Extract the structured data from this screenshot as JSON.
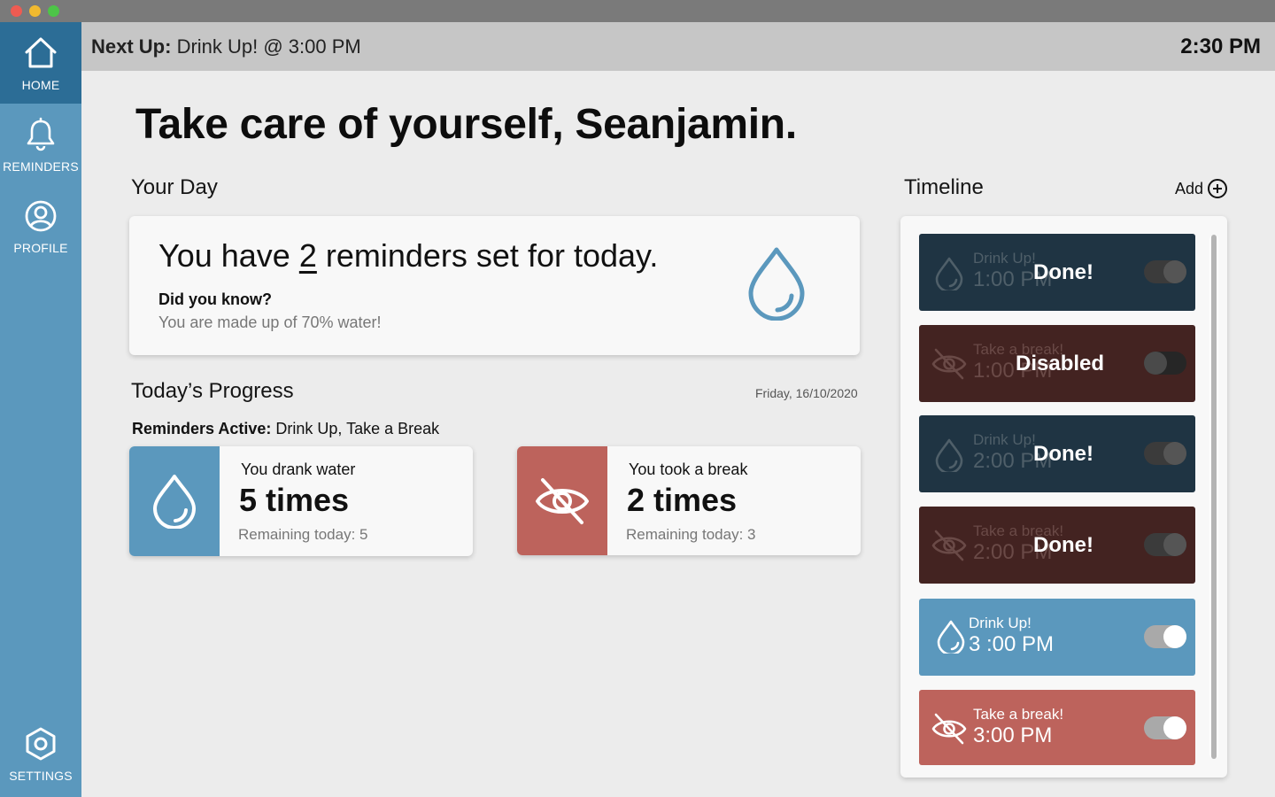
{
  "nav": {
    "home": {
      "label": "HOME",
      "icon": "home-icon"
    },
    "reminders": {
      "label": "REMINDERS",
      "icon": "bell-icon"
    },
    "profile": {
      "label": "PROFILE",
      "icon": "user-circle-icon"
    },
    "settings": {
      "label": "SETTINGS",
      "icon": "hexagon-gear-icon"
    }
  },
  "topbar": {
    "next_up_label": "Next Up:",
    "next_up_value": " Drink Up! @ 3:00 PM",
    "clock": "2:30 PM"
  },
  "greeting": "Take care of yourself, Seanjamin.",
  "your_day": {
    "title": "Your Day",
    "line_prefix": "You have ",
    "count": "2",
    "line_suffix": " reminders set for today.",
    "did_you_know_title": "Did you know?",
    "did_you_know_text": "You are made up of 70% water!"
  },
  "progress": {
    "title": "Today’s Progress",
    "date": "Friday, 16/10/2020",
    "active_label": "Reminders Active:",
    "active_value": " Drink Up, Take a Break",
    "water": {
      "line1": "You drank water",
      "count": "5 times",
      "remaining": "Remaining today: 5"
    },
    "break": {
      "line1": "You took a break",
      "count": "2 times",
      "remaining": "Remaining today: 3"
    }
  },
  "timeline": {
    "title": "Timeline",
    "add_label": "Add",
    "items": [
      {
        "name": "Drink Up!",
        "time": "1:00 PM",
        "status": "Done!",
        "toggle": "on"
      },
      {
        "name": "Take a break!",
        "time": "1:00 PM",
        "status": "Disabled",
        "toggle": "off"
      },
      {
        "name": "Drink Up!",
        "time": "2:00 PM",
        "status": "Done!",
        "toggle": "on"
      },
      {
        "name": "Take a break!",
        "time": "2:00 PM",
        "status": "Done!",
        "toggle": "on"
      },
      {
        "name": "Drink Up!",
        "time": "3 :00 PM",
        "status": "",
        "toggle": "on"
      },
      {
        "name": "Take a break!",
        "time": "3:00 PM",
        "status": "",
        "toggle": "on"
      }
    ]
  },
  "colors": {
    "sidebar": "#5b98bd",
    "sidebar_active": "#2c6d96",
    "water_accent": "#5b98bd",
    "break_accent": "#bd635c",
    "done_water": "#1f3443",
    "done_break": "#432321"
  }
}
